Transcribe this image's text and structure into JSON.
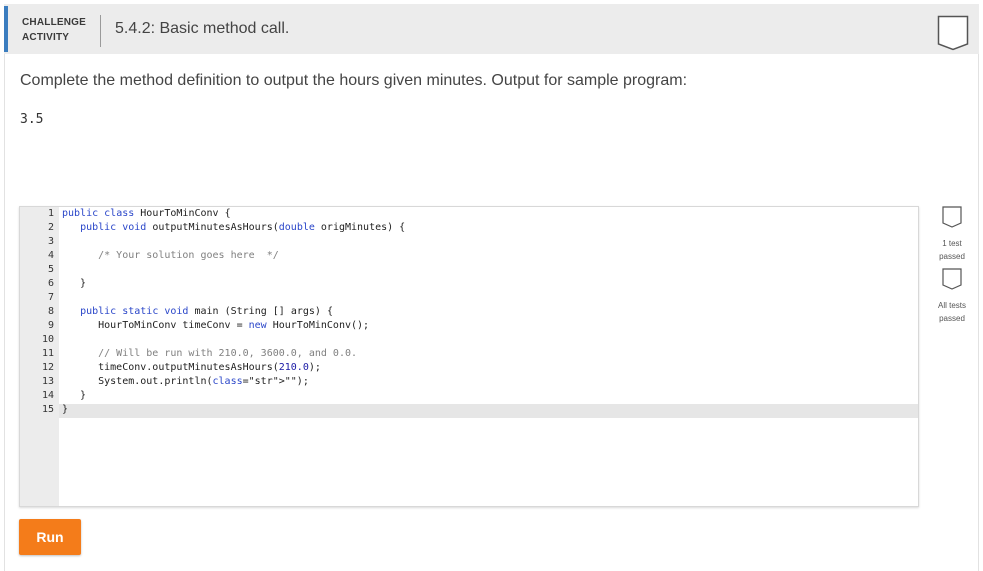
{
  "header": {
    "tag_line1": "CHALLENGE",
    "tag_line2": "ACTIVITY",
    "title": "5.4.2: Basic method call."
  },
  "prompt": "Complete the method definition to output the hours given minutes. Output for sample program:",
  "sample_output": "3.5",
  "editor": {
    "line_numbers": [
      "1",
      "2",
      "3",
      "4",
      "5",
      "6",
      "7",
      "8",
      "9",
      "10",
      "11",
      "12",
      "13",
      "14",
      "15"
    ],
    "lines": [
      [
        "public class HourToMinConv {"
      ],
      [
        "   public void outputMinutesAsHours(double origMinutes) {"
      ],
      [
        ""
      ],
      [
        "      /* Your solution goes here  */"
      ],
      [
        ""
      ],
      [
        "   }"
      ],
      [
        ""
      ],
      [
        "   public static void main (String [] args) {"
      ],
      [
        "      HourToMinConv timeConv = new HourToMinConv();"
      ],
      [
        ""
      ],
      [
        "      // Will be run with 210.0, 3600.0, and 0.0."
      ],
      [
        "      timeConv.outputMinutesAsHours(210.0);"
      ],
      [
        "      System.out.println(\"\");"
      ],
      [
        "   }"
      ],
      [
        "}"
      ]
    ]
  },
  "tests": {
    "test1_line1": "1 test",
    "test1_line2": "passed",
    "test2_line1": "All tests",
    "test2_line2": "passed"
  },
  "run_label": "Run",
  "colors": {
    "accent": "#3b7dbf",
    "run_button": "#f47c1a",
    "keyword": "#2a46c9",
    "comment": "#808080"
  },
  "icons": {
    "bookmark": "bookmark-icon",
    "test_status": "checkbox-icon"
  }
}
